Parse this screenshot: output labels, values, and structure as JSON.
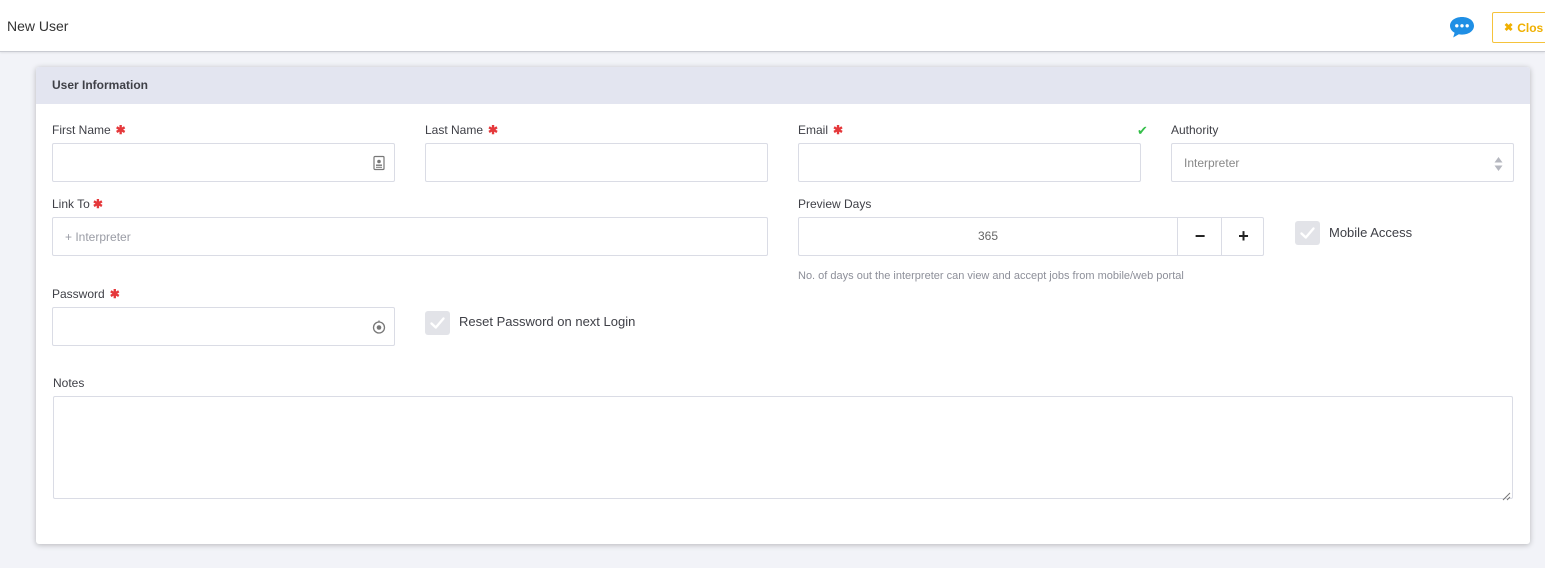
{
  "header": {
    "title": "New User",
    "close_label": "Clos",
    "close_icon": "✖",
    "accent_close": "#f5c33b",
    "accent_chat": "#1f8fe5"
  },
  "card": {
    "title": "User Information",
    "required_mark": "✱",
    "fields": {
      "first_name": {
        "label": "First Name",
        "value": "",
        "placeholder": ""
      },
      "last_name": {
        "label": "Last Name",
        "value": "",
        "placeholder": ""
      },
      "email": {
        "label": "Email",
        "value": "",
        "placeholder": ""
      },
      "authority": {
        "label": "Authority",
        "value": "Interpreter",
        "status_icon": "✔"
      },
      "link_to": {
        "label": "Link To",
        "placeholder": "+ Interpreter"
      },
      "preview_days": {
        "label": "Preview Days",
        "value": "365",
        "minus": "−",
        "plus": "+",
        "hint": "No. of days out the interpreter can view and accept jobs from mobile/web portal"
      },
      "mobile_access": {
        "label": "Mobile Access",
        "checked": true
      },
      "password": {
        "label": "Password",
        "value": ""
      },
      "reset_password": {
        "label": "Reset Password on next Login",
        "checked": true
      },
      "notes": {
        "label": "Notes",
        "value": ""
      }
    }
  }
}
